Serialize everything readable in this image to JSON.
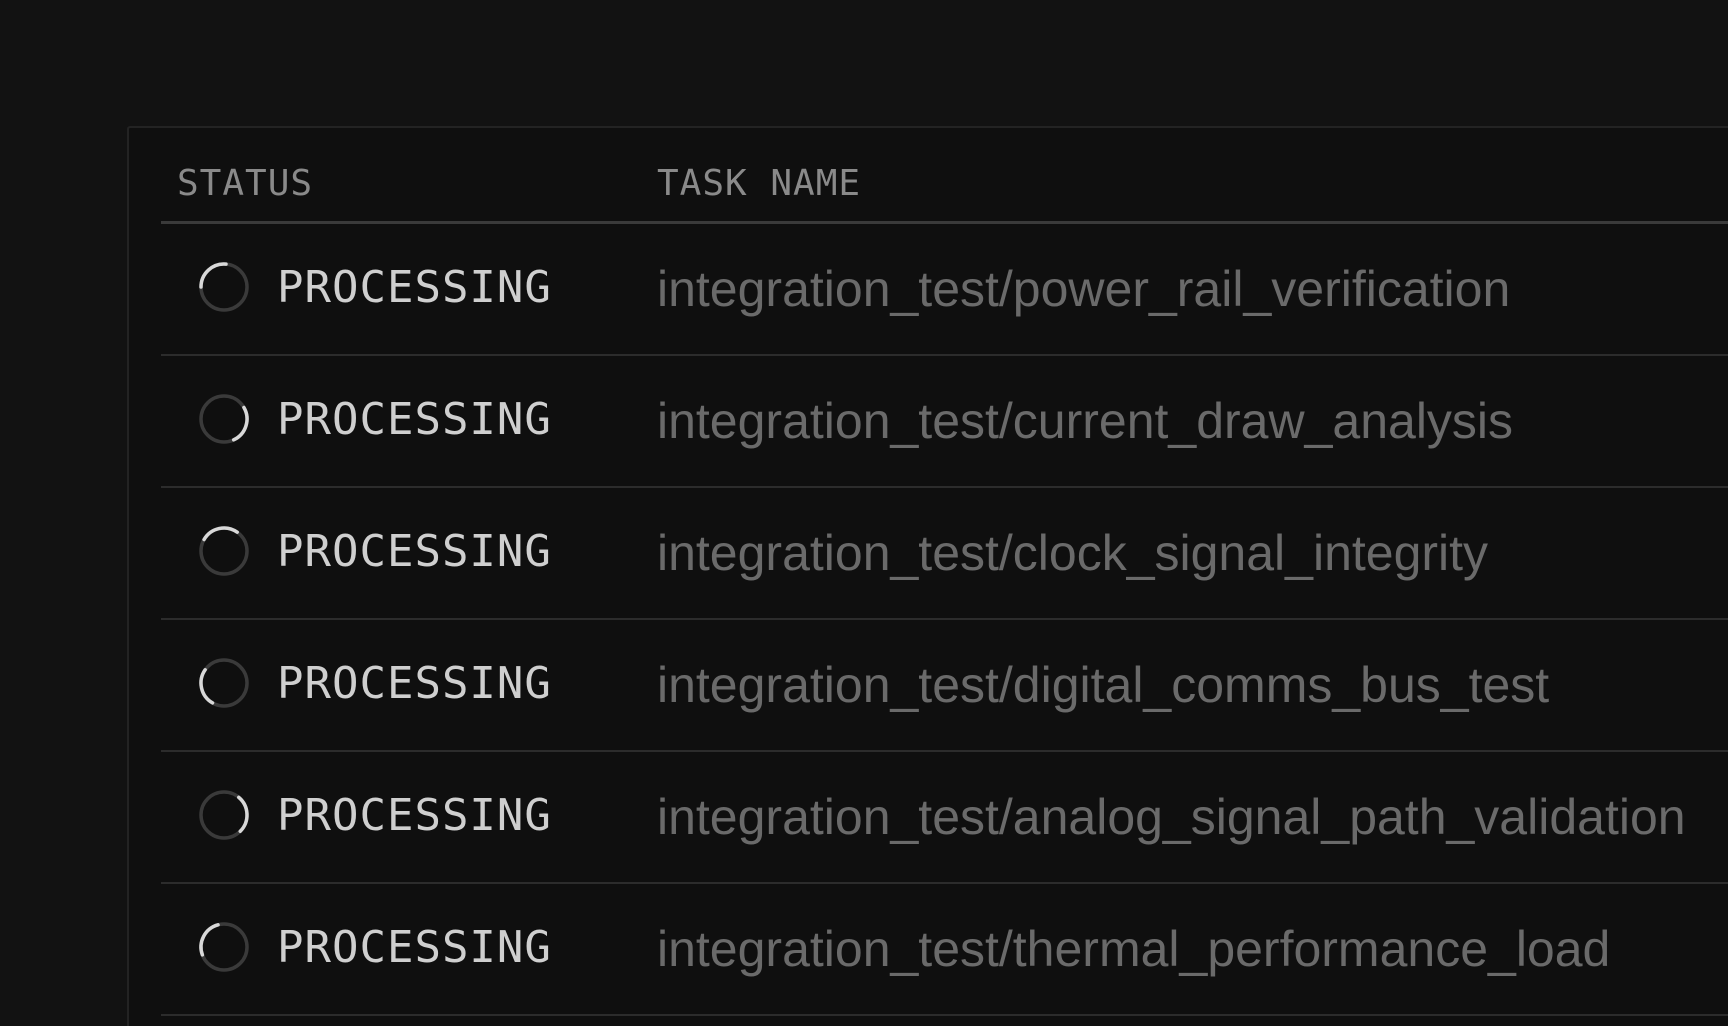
{
  "table": {
    "headers": {
      "status": "STATUS",
      "task_name": "TASK NAME"
    },
    "rows": [
      {
        "status": "PROCESSING",
        "task": "integration_test/power_rail_verification",
        "spinner_icon": "loading-spinner-icon"
      },
      {
        "status": "PROCESSING",
        "task": "integration_test/current_draw_analysis",
        "spinner_icon": "loading-spinner-icon"
      },
      {
        "status": "PROCESSING",
        "task": "integration_test/clock_signal_integrity",
        "spinner_icon": "loading-spinner-icon"
      },
      {
        "status": "PROCESSING",
        "task": "integration_test/digital_comms_bus_test",
        "spinner_icon": "loading-spinner-icon"
      },
      {
        "status": "PROCESSING",
        "task": "integration_test/analog_signal_path_validation",
        "spinner_icon": "loading-spinner-icon"
      },
      {
        "status": "PROCESSING",
        "task": "integration_test/thermal_performance_load",
        "spinner_icon": "loading-spinner-icon"
      }
    ]
  },
  "colors": {
    "background": "#121212",
    "panel": "#0f0f0f",
    "spinner_track": "#3a3a3a",
    "spinner_arc": "#d8d8d8",
    "status_text": "#cfcfcf",
    "task_text": "#6a6a6a"
  }
}
